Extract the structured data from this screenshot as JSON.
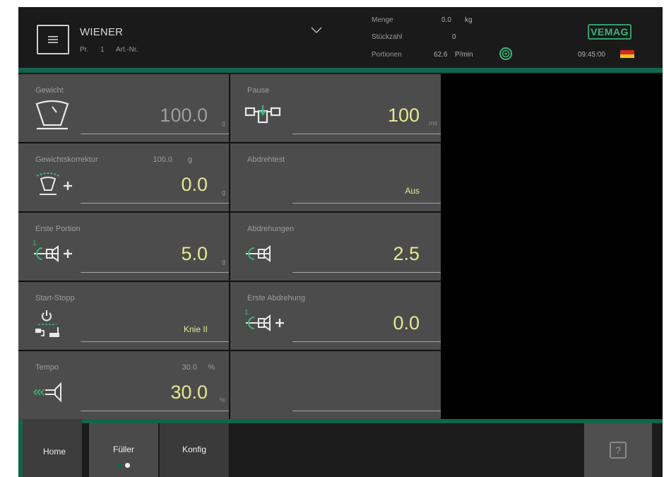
{
  "header": {
    "product_name": "WIENER",
    "pr_label": "Pr.",
    "pr_value": "1",
    "art_label": "Art.-Nr.",
    "stats": [
      {
        "label": "Menge",
        "value": "0.0",
        "unit": "kg"
      },
      {
        "label": "Stückzahl",
        "value": "0",
        "unit": ""
      },
      {
        "label": "Portionen",
        "value": "62.6",
        "unit": "P/min"
      }
    ],
    "logo": "VEMAG",
    "time": "09:45:00",
    "flag_colors": [
      "#1c1c1c",
      "#d62a1e",
      "#f3c316"
    ]
  },
  "tiles": {
    "gewicht": {
      "label": "Gewicht",
      "value": "100.0",
      "unit": "g"
    },
    "pause": {
      "label": "Pause",
      "value": "100",
      "unit": "ms"
    },
    "gewichtskorrektur": {
      "label": "Gewichtskorrektur",
      "sub_value": "100.0",
      "sub_unit": "g",
      "value": "0.0",
      "unit": "g"
    },
    "abdrehtest": {
      "label": "Abdrehtest",
      "value": "Aus"
    },
    "erste_portion": {
      "label": "Erste Portion",
      "value": "5.0",
      "unit": "g",
      "badge": "1."
    },
    "abdrehungen": {
      "label": "Abdrehungen",
      "value": "2.5"
    },
    "start_stopp": {
      "label": "Start-Stopp",
      "value": "Knie II"
    },
    "erste_abdrehung": {
      "label": "Erste Abdrehung",
      "value": "0.0",
      "badge": "1."
    },
    "tempo": {
      "label": "Tempo",
      "sub_value": "30.0",
      "sub_unit": "%",
      "value": "30.0",
      "unit": "%"
    }
  },
  "footer": {
    "home": "Home",
    "filler": "Füller",
    "konfig": "Konfig",
    "help": "?"
  },
  "icons": {
    "menu": "hamburger-icon",
    "chevron": "chevron-down-icon",
    "target": "target-icon",
    "scale": "scale-icon",
    "pause": "pause-separator-icon",
    "weight_correction": "weight-correction-icon",
    "first_portion": "first-portion-icon",
    "twists": "twist-icon",
    "start_stop": "start-stop-icon",
    "first_twist": "first-twist-icon",
    "tempo": "tempo-icon"
  },
  "colors": {
    "accent_green": "#12654d",
    "value_yellow": "#e4e892",
    "icon_green": "#3cb57b"
  }
}
